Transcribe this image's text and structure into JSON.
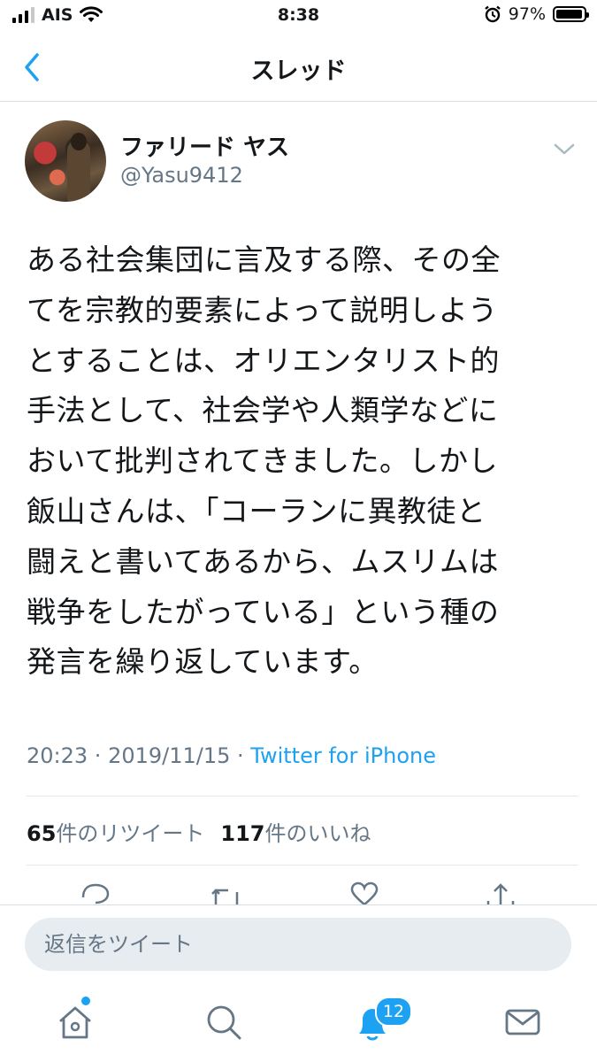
{
  "status_bar": {
    "carrier": "AIS",
    "time": "8:38",
    "battery": "97%",
    "battery_level": 0.97
  },
  "nav": {
    "title": "スレッド"
  },
  "tweet": {
    "display_name": "ファリード ヤス",
    "handle": "@Yasu9412",
    "text": "ある社会集団に言及する際、その全\nてを宗教的要素によって説明しよう\nとすることは、オリエンタリスト的\n手法として、社会学や人類学などに\nおいて批判されてきました。しかし\n飯山さんは、「コーランに異教徒と\n闘えと書いてあるから、ムスリムは\n戦争をしたがっている」という種の\n発言を繰り返しています。",
    "time": "20:23",
    "separator": " · ",
    "date": "2019/11/15",
    "source": "Twitter for iPhone",
    "retweets_count": "65",
    "retweets_label": "件のリツイート",
    "likes_count": "117",
    "likes_label": "件のいいね"
  },
  "reply": {
    "placeholder": "返信をツイート"
  },
  "tabbar": {
    "notifications_badge": "12"
  },
  "colors": {
    "accent": "#1da1f2",
    "text": "#14171a",
    "secondary": "#657786",
    "divider": "#e1e8ed"
  },
  "icons": [
    "back-chevron-icon",
    "caret-down-icon",
    "reply-icon",
    "retweet-icon",
    "like-icon",
    "share-icon",
    "home-icon",
    "search-icon",
    "notifications-icon",
    "messages-icon",
    "wifi-icon",
    "alarm-icon",
    "battery-icon",
    "signal-icon"
  ]
}
